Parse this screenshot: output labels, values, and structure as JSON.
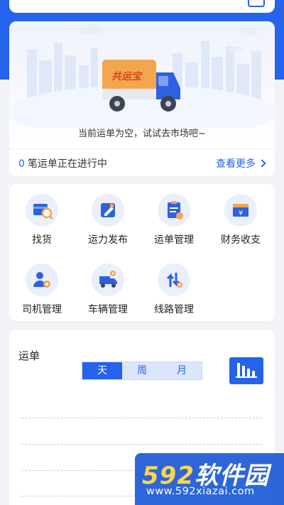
{
  "empty_state": {
    "illustration": "delivery-truck-city",
    "truck_brand": "共运宝",
    "message": "当前运单为空，试试去市场吧~"
  },
  "ongoing": {
    "count": "0",
    "label": "笔运单正在进行中",
    "view_more": "查看更多"
  },
  "menu": [
    {
      "label": "找货",
      "icon": "search-goods-icon"
    },
    {
      "label": "运力发布",
      "icon": "edit-icon"
    },
    {
      "label": "运单管理",
      "icon": "clipboard-icon"
    },
    {
      "label": "财务收支",
      "icon": "wallet-yen-icon"
    },
    {
      "label": "司机管理",
      "icon": "driver-gear-icon"
    },
    {
      "label": "车辆管理",
      "icon": "truck-gear-icon"
    },
    {
      "label": "线路管理",
      "icon": "route-arrows-icon"
    }
  ],
  "stats": {
    "title": "运单",
    "periods": [
      "天",
      "周",
      "月"
    ],
    "selected_period": "天",
    "chart_button_icon": "bar-chart-icon"
  },
  "watermark": {
    "logo_num": "592",
    "logo_text": "软件园",
    "url": "www.592xiazai.com"
  },
  "colors": {
    "accent": "#2563eb",
    "icon_bg": "#e9effc",
    "truck": "#f0a04b"
  }
}
